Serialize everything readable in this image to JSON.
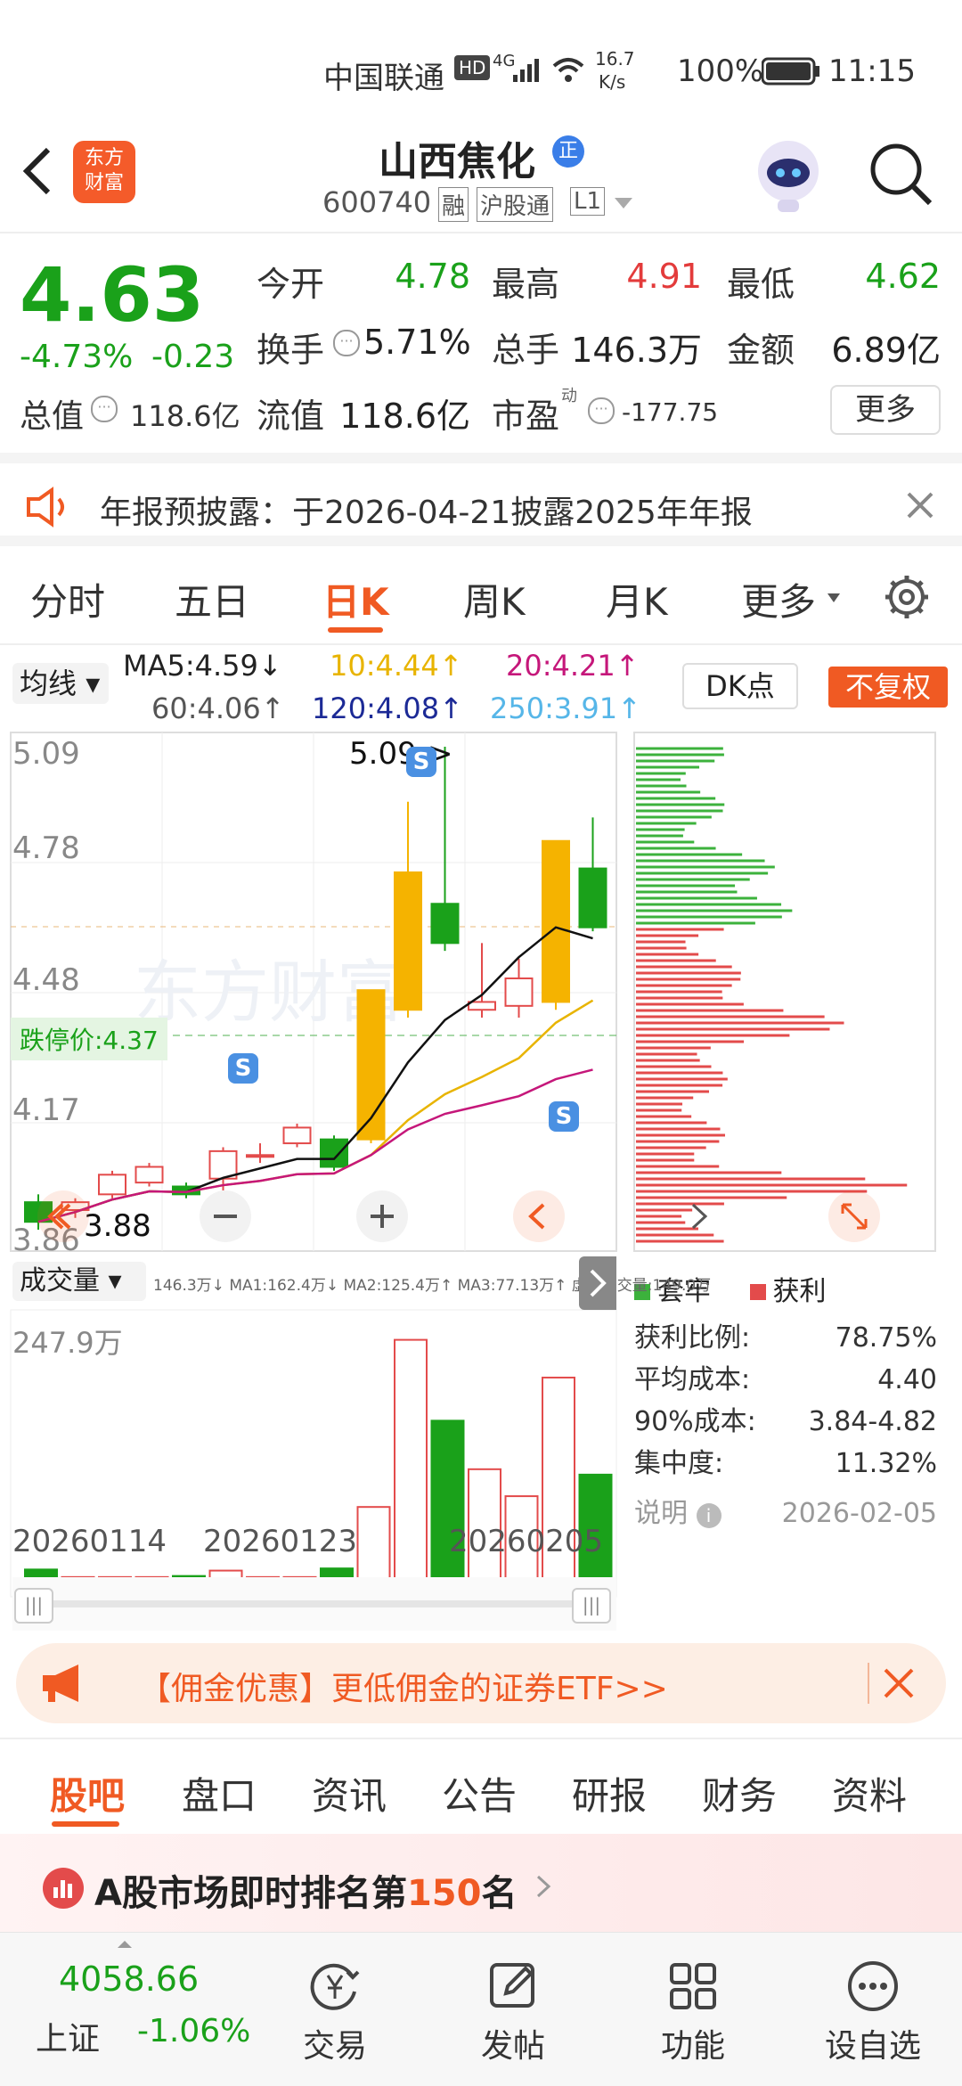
{
  "status_bar": {
    "carrier": "中国联通",
    "hd": "HD",
    "net": "4G",
    "speed_top": "16.7",
    "speed_bottom": "K/s",
    "battery": "100%",
    "time": "11:15"
  },
  "header": {
    "brand_line1": "东方",
    "brand_line2": "财富",
    "title": "山西焦化",
    "badge": "正",
    "code": "600740",
    "tags": [
      "融",
      "沪股通",
      "L1"
    ]
  },
  "quote": {
    "price": "4.63",
    "change_pct": "-4.73%",
    "change": "-0.23",
    "open_label": "今开",
    "open": "4.78",
    "high_label": "最高",
    "high": "4.91",
    "low_label": "最低",
    "low": "4.62",
    "turnover_label": "换手",
    "turnover": "5.71%",
    "volume_label": "总手",
    "volume": "146.3万",
    "amount_label": "金额",
    "amount": "6.89亿",
    "mcap_label": "总值",
    "mcap": "118.6亿",
    "float_label": "流值",
    "float": "118.6亿",
    "pe_label": "市盈",
    "pe_sup": "动",
    "pe": "-177.75",
    "more": "更多"
  },
  "notice": {
    "text": "年报预披露：于2026-04-21披露2025年年报"
  },
  "ktabs": [
    "分时",
    "五日",
    "日K",
    "周K",
    "月K",
    "更多"
  ],
  "ktab_active": 2,
  "ma": {
    "selector": "均线",
    "ma5": "MA5:4.59↓",
    "ma10": "10:4.44↑",
    "ma20": "20:4.21↑",
    "ma60": "60:4.06↑",
    "ma120": "120:4.08↑",
    "ma250": "250:3.91↑",
    "dk": "DK点",
    "fq": "不复权"
  },
  "kline": {
    "y_labels": [
      "5.09",
      "4.78",
      "4.48",
      "4.17",
      "3.86"
    ],
    "high_mark": "5.09->",
    "low_mark": "3.88",
    "limit_down": "跌停价:4.37",
    "watermark": "东方财富"
  },
  "volume": {
    "selector": "成交量",
    "stats": "146.3万↓ MA1:162.4万↓ MA2:125.4万↑ MA3:77.13万↑ 虚拟成交量:149.0万",
    "max": "247.9万",
    "dates": [
      "20260114",
      "20260123",
      "20260205"
    ]
  },
  "chips": {
    "legend_trap": "套牢",
    "legend_profit": "获利",
    "rows": [
      {
        "k": "获利比例:",
        "v": "78.75%"
      },
      {
        "k": "平均成本:",
        "v": "4.40"
      },
      {
        "k": "90%成本:",
        "v": "3.84-4.82"
      },
      {
        "k": "集中度:",
        "v": "11.32%"
      }
    ],
    "note": "说明",
    "date": "2026-02-05"
  },
  "promo": {
    "text": "【佣金优惠】更低佣金的证券ETF>>"
  },
  "ftabs": [
    "股吧",
    "盘口",
    "资讯",
    "公告",
    "研报",
    "财务",
    "资料"
  ],
  "rank": {
    "prefix": "A股市场即时排名第",
    "num": "150",
    "suffix": "名"
  },
  "index": {
    "value": "4058.66",
    "name": "上证",
    "change": "-1.06%"
  },
  "bottom_nav": [
    "交易",
    "发帖",
    "功能",
    "设自选"
  ],
  "chart_data": {
    "type": "candlestick",
    "y_range": [
      3.86,
      5.09
    ],
    "candles": [
      {
        "o": 3.93,
        "c": 3.88,
        "h": 3.95,
        "l": 3.86
      },
      {
        "o": 3.91,
        "c": 3.93,
        "h": 3.94,
        "l": 3.89
      },
      {
        "o": 3.95,
        "c": 4.0,
        "h": 4.01,
        "l": 3.94
      },
      {
        "o": 3.98,
        "c": 4.02,
        "h": 4.03,
        "l": 3.97
      },
      {
        "o": 3.97,
        "c": 3.95,
        "h": 3.98,
        "l": 3.94
      },
      {
        "o": 3.99,
        "c": 4.06,
        "h": 4.07,
        "l": 3.96
      },
      {
        "o": 4.05,
        "c": 4.05,
        "h": 4.08,
        "l": 4.03
      },
      {
        "o": 4.08,
        "c": 4.12,
        "h": 4.13,
        "l": 4.07
      },
      {
        "o": 4.09,
        "c": 4.02,
        "h": 4.1,
        "l": 4.01
      },
      {
        "o": 4.09,
        "c": 4.47,
        "h": 4.47,
        "l": 4.08
      },
      {
        "o": 4.42,
        "c": 4.77,
        "h": 4.95,
        "l": 4.4
      },
      {
        "o": 4.69,
        "c": 4.59,
        "h": 5.09,
        "l": 4.57
      },
      {
        "o": 4.42,
        "c": 4.44,
        "h": 4.59,
        "l": 4.4
      },
      {
        "o": 4.43,
        "c": 4.5,
        "h": 4.55,
        "l": 4.4
      },
      {
        "o": 4.44,
        "c": 4.85,
        "h": 4.85,
        "l": 4.42
      },
      {
        "o": 4.78,
        "c": 4.63,
        "h": 4.91,
        "l": 4.62
      }
    ],
    "volumes": [
      22,
      15,
      15,
      15,
      16,
      21,
      15,
      15,
      23,
      80,
      235,
      160,
      115,
      90,
      200,
      110
    ],
    "volume_max": 247.9
  }
}
